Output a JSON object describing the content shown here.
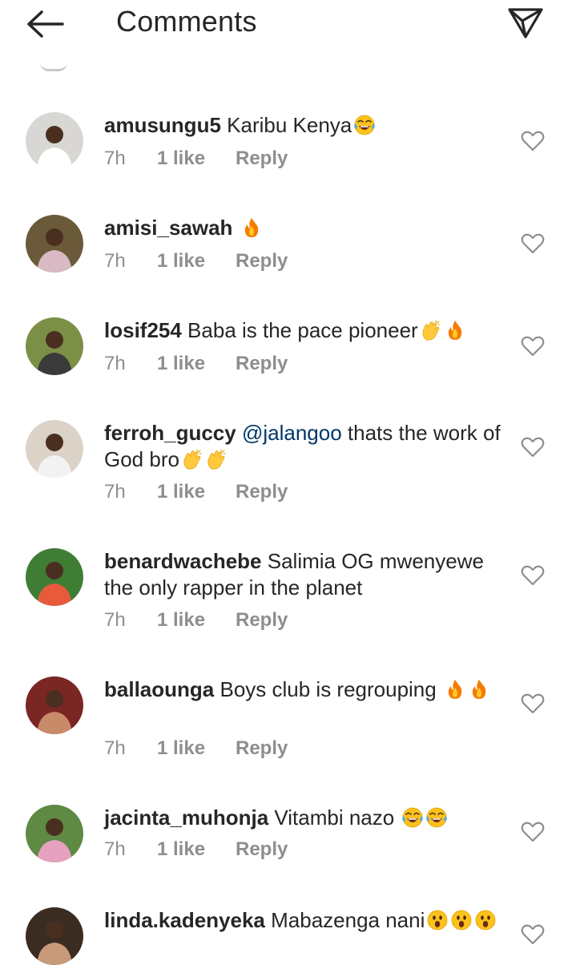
{
  "header": {
    "title": "Comments"
  },
  "comments": [
    {
      "username": "amusungu5",
      "segments": [
        {
          "t": " Karibu Kenya"
        }
      ],
      "emoji": [
        "laugh-tears"
      ],
      "time": "7h",
      "likes": "1 like",
      "reply": "Reply",
      "avatar": {
        "bg": "#d9d7d4",
        "accent": "#ffffff"
      }
    },
    {
      "username": "amisi_sawah",
      "segments": [
        {
          "t": " "
        }
      ],
      "emoji": [
        "fire"
      ],
      "time": "7h",
      "likes": "1 like",
      "reply": "Reply",
      "avatar": {
        "bg": "#6a5a3a",
        "accent": "#d8b9c4"
      }
    },
    {
      "username": "losif254",
      "segments": [
        {
          "t": " Baba is the pace pioneer"
        }
      ],
      "emoji": [
        "clap",
        "fire"
      ],
      "time": "7h",
      "likes": "1 like",
      "reply": "Reply",
      "avatar": {
        "bg": "#7c8f47",
        "accent": "#3a3a3a"
      }
    },
    {
      "username": "ferroh_guccy",
      "segments": [
        {
          "t": " "
        },
        {
          "t": "@jalangoo",
          "mention": true
        },
        {
          "t": " thats the work of God bro"
        }
      ],
      "emoji": [
        "clap",
        "clap"
      ],
      "time": "7h",
      "likes": "1 like",
      "reply": "Reply",
      "avatar": {
        "bg": "#dcd3c8",
        "accent": "#f2f2f2"
      }
    },
    {
      "username": "benardwachebe",
      "segments": [
        {
          "t": " Salimia OG mwenyewe the only rapper in the planet"
        }
      ],
      "emoji": [],
      "time": "7h",
      "likes": "1 like",
      "reply": "Reply",
      "avatar": {
        "bg": "#3f7d35",
        "accent": "#e85a3c"
      }
    },
    {
      "username": "ballaounga",
      "segments": [
        {
          "t": " Boys club is regrouping "
        }
      ],
      "emoji": [
        "fire",
        "fire"
      ],
      "time": "7h",
      "likes": "1 like",
      "reply": "Reply",
      "avatar": {
        "bg": "#7a2622",
        "accent": "#c98a6a"
      }
    },
    {
      "username": "jacinta_muhonja",
      "segments": [
        {
          "t": " Vitambi nazo "
        }
      ],
      "emoji": [
        "laugh-tears",
        "laugh-tears"
      ],
      "time": "7h",
      "likes": "1 like",
      "reply": "Reply",
      "avatar": {
        "bg": "#5e8a44",
        "accent": "#e6a0c0"
      }
    },
    {
      "username": "linda.kadenyeka",
      "segments": [
        {
          "t": " Mabazenga nani"
        }
      ],
      "emoji": [
        "astonished",
        "astonished",
        "astonished"
      ],
      "time": "",
      "likes": "",
      "reply": "",
      "avatar": {
        "bg": "#3b2c22",
        "accent": "#c89a7a"
      }
    }
  ]
}
